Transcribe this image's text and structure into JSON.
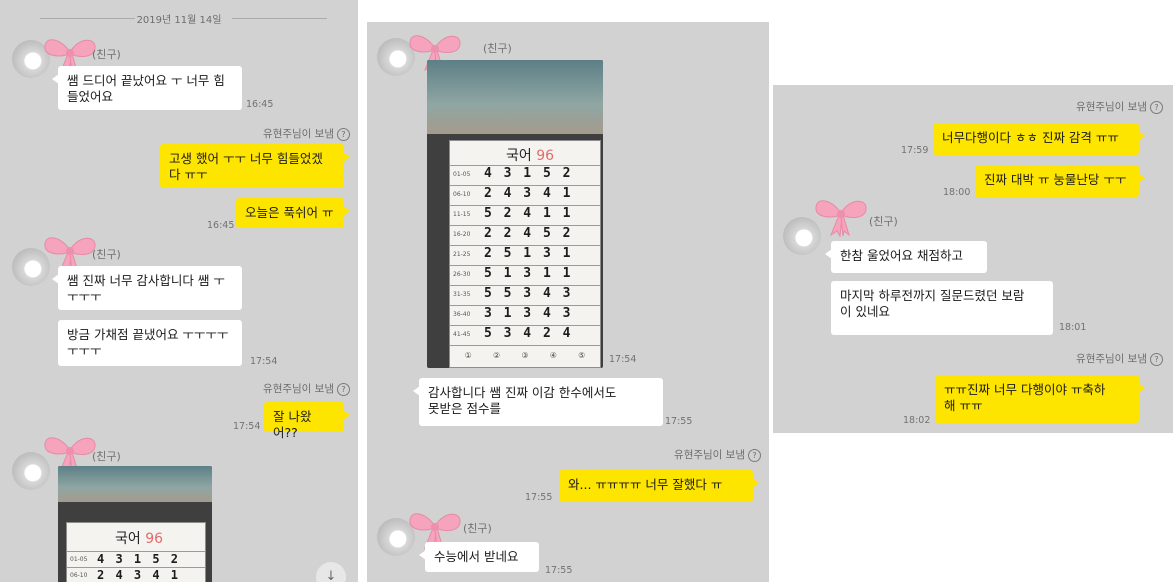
{
  "panel1": {
    "date": "2019년 11월 14일",
    "friend_tag": "(친구)",
    "msg1_line1": "쌤 드디어 끝났어요 ㅜ 너무 힘",
    "msg1_line2": "들었어요",
    "msg1_time": "16:45",
    "sender_label": "유현주님이 보냄",
    "reply1_line1": "고생 했어 ㅜㅜ 너무 힘들었겠",
    "reply1_line2": "다 ㅠㅜ",
    "reply2": "오늘은 푹쉬어 ㅠ",
    "reply_time": "16:45",
    "msg2_line1": "쌤 진짜 너무 감사합니다 쌤 ㅜ",
    "msg2_line2": "ㅜㅜㅜ",
    "msg3_line1": "방금 가채점 끝냈어요 ㅜㅜㅜㅜ",
    "msg3_line2": "ㅜㅜㅜ",
    "msg3_time": "17:54",
    "reply3": "잘 나왔어??",
    "reply3_time": "17:54",
    "sheet_title": "국어",
    "sheet_score": "96",
    "rows": [
      {
        "label": "01-05",
        "digits": "4 3 1 5 2"
      },
      {
        "label": "06-10",
        "digits": "2 4 3 4 1"
      }
    ],
    "scroll_icon": "↓"
  },
  "panel2": {
    "friend_tag": "(친구)",
    "sheet_title": "국어",
    "sheet_score": "96",
    "rows": [
      {
        "label": "01-05",
        "digits": "4 3 1 5 2"
      },
      {
        "label": "06-10",
        "digits": "2 4 3 4 1"
      },
      {
        "label": "11-15",
        "digits": "5 2 4 1 1"
      },
      {
        "label": "16-20",
        "digits": "2 2 4 5 2"
      },
      {
        "label": "21-25",
        "digits": "2 5 1 3 1"
      },
      {
        "label": "26-30",
        "digits": "5 1 3 1 1"
      },
      {
        "label": "31-35",
        "digits": "5 5  3 4 3"
      },
      {
        "label": "36-40",
        "digits": "3 1 3 4 3"
      },
      {
        "label": "41-45",
        "digits": "5 3 4 2 4"
      }
    ],
    "circles": [
      "①",
      "②",
      "③",
      "④",
      "⑤"
    ],
    "photo_time": "17:54",
    "msg1_line1": "감사합니다 쌤 진짜 이감 한수에서도",
    "msg1_line2": "못받은 점수를",
    "msg1_time": "17:55",
    "sender_label": "유현주님이 보냄",
    "reply1": "와... ㅠㅠㅠㅠ 너무 잘했다 ㅠ",
    "reply1_time": "17:55",
    "friend_tag2": "(친구)",
    "msg2": "수능에서 받네요",
    "msg2_time": "17:55"
  },
  "panel3": {
    "sender_label": "유현주님이 보냄",
    "reply1": "너무다행이다 ㅎㅎ 진짜 감격 ㅠㅠ",
    "reply1_time": "17:59",
    "reply2": "진짜 대박 ㅠ 눙물난당 ㅜㅜ",
    "reply2_time": "18:00",
    "friend_tag": "(친구)",
    "msg1": "한참 울었어요 채점하고",
    "msg2_line1": "마지막 하루전까지 질문드렸던 보람",
    "msg2_line2": "이 있네요",
    "msg2_time": "18:01",
    "sender_label2": "유현주님이 보냄",
    "reply3_line1": "ㅠㅠ진짜 너무 다행이야 ㅠ축하",
    "reply3_line2": "해 ㅠㅠ",
    "reply3_time": "18:02"
  },
  "common": {
    "help_glyph": "?"
  },
  "colors": {
    "background": "#d2d2d2",
    "my_bubble": "#fee500",
    "their_bubble": "#ffffff",
    "bow": "#f6a4bd"
  }
}
